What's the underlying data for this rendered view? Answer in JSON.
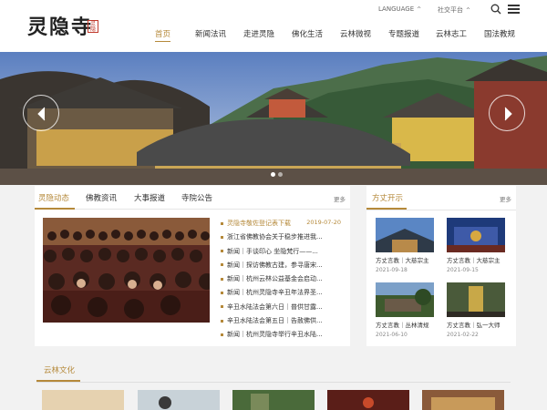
{
  "header": {
    "logo_text": "灵隐寺",
    "seal_text": "灵隐",
    "language_label": "LANGUAGE",
    "social_label": "社交平台",
    "nav": [
      {
        "label": "首页",
        "active": true
      },
      {
        "label": "新闻法讯"
      },
      {
        "label": "走进灵隐"
      },
      {
        "label": "佛化生活"
      },
      {
        "label": "云林微视"
      },
      {
        "label": "专题报道"
      },
      {
        "label": "云林志工"
      },
      {
        "label": "国法教规"
      }
    ]
  },
  "hero": {
    "slides": 2,
    "active_slide": 1
  },
  "news": {
    "tabs": [
      "灵隐动态",
      "佛教资讯",
      "大事报道",
      "寺院公告"
    ],
    "more_label": "更多",
    "items": [
      {
        "title": "灵隐寺敬佐登记表下载",
        "date": "2019-07-20"
      },
      {
        "title": "浙江省佛教协会关于稳步推进我..."
      },
      {
        "title": "新闻｜手谈印心 坐隐梵行——..."
      },
      {
        "title": "新闻｜探访佛教古建，参寻唐宋..."
      },
      {
        "title": "新闻｜杭州云林公益基金会启动..."
      },
      {
        "title": "新闻｜杭州灵隐寺辛丑年法界圣..."
      },
      {
        "title": "辛丑水陆法会第六日｜普供甘露..."
      },
      {
        "title": "辛丑水陆法会第五日｜告赦佛供..."
      },
      {
        "title": "新闻｜杭州灵隐寺举行辛丑水陆..."
      }
    ]
  },
  "abbot": {
    "title": "方丈开示",
    "more_label": "更多",
    "items": [
      {
        "caption": "方丈言教｜大慈宗主",
        "date": "2021-09-18"
      },
      {
        "caption": "方丈言教｜大慈宗主",
        "date": "2021-09-15"
      },
      {
        "caption": "方丈言教｜丛林清规",
        "date": "2021-06-10"
      },
      {
        "caption": "方丈言教｜弘一大师",
        "date": "2021-02-22"
      }
    ]
  },
  "culture": {
    "title": "云林文化"
  },
  "colors": {
    "accent": "#b5893a",
    "text": "#333333",
    "background": "#f2f2f2"
  }
}
